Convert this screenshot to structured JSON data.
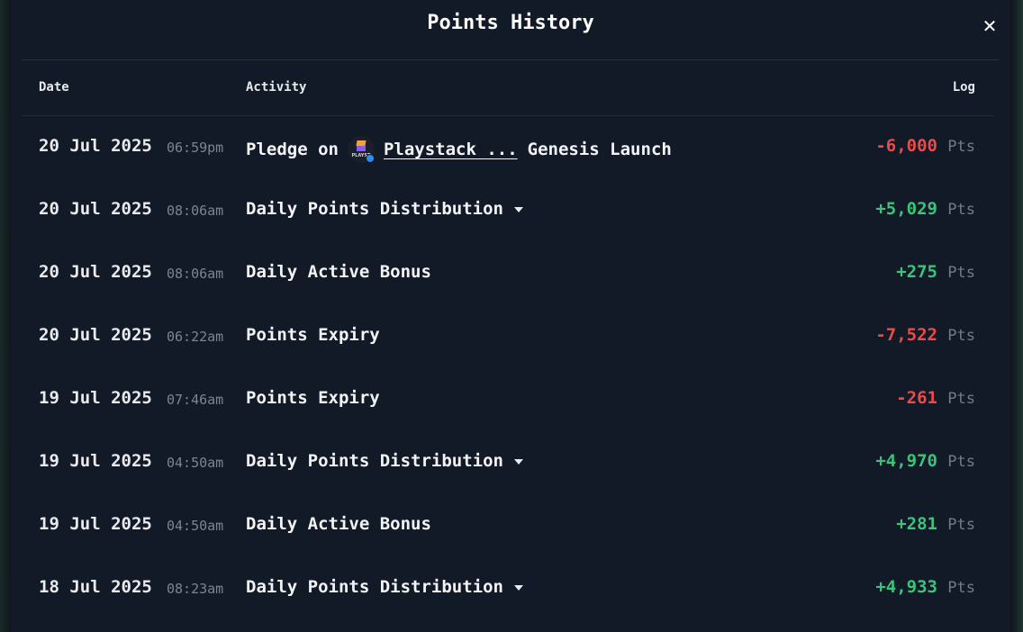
{
  "modal": {
    "title": "Points History",
    "close_label": "✕"
  },
  "columns": {
    "date": "Date",
    "activity": "Activity",
    "log": "Log"
  },
  "colors": {
    "positive": "#38c47a",
    "negative": "#ea4b4b"
  },
  "rows": [
    {
      "date": "20 Jul 2025",
      "time": "06:59pm",
      "activity_prefix": "Pledge on",
      "project_logo_text": "PLAYST",
      "project_link": "Playstack ...",
      "activity_suffix": "Genesis Launch",
      "amount": "-6,000",
      "unit": "Pts",
      "sign": "negative",
      "expandable": false
    },
    {
      "date": "20 Jul 2025",
      "time": "08:06am",
      "activity": "Daily Points Distribution",
      "amount": "+5,029",
      "unit": "Pts",
      "sign": "positive",
      "expandable": true
    },
    {
      "date": "20 Jul 2025",
      "time": "08:06am",
      "activity": "Daily Active Bonus",
      "amount": "+275",
      "unit": "Pts",
      "sign": "positive",
      "expandable": false
    },
    {
      "date": "20 Jul 2025",
      "time": "06:22am",
      "activity": "Points Expiry",
      "amount": "-7,522",
      "unit": "Pts",
      "sign": "negative",
      "expandable": false
    },
    {
      "date": "19 Jul 2025",
      "time": "07:46am",
      "activity": "Points Expiry",
      "amount": "-261",
      "unit": "Pts",
      "sign": "negative",
      "expandable": false
    },
    {
      "date": "19 Jul 2025",
      "time": "04:50am",
      "activity": "Daily Points Distribution",
      "amount": "+4,970",
      "unit": "Pts",
      "sign": "positive",
      "expandable": true
    },
    {
      "date": "19 Jul 2025",
      "time": "04:50am",
      "activity": "Daily Active Bonus",
      "amount": "+281",
      "unit": "Pts",
      "sign": "positive",
      "expandable": false
    },
    {
      "date": "18 Jul 2025",
      "time": "08:23am",
      "activity": "Daily Points Distribution",
      "amount": "+4,933",
      "unit": "Pts",
      "sign": "positive",
      "expandable": true
    }
  ]
}
